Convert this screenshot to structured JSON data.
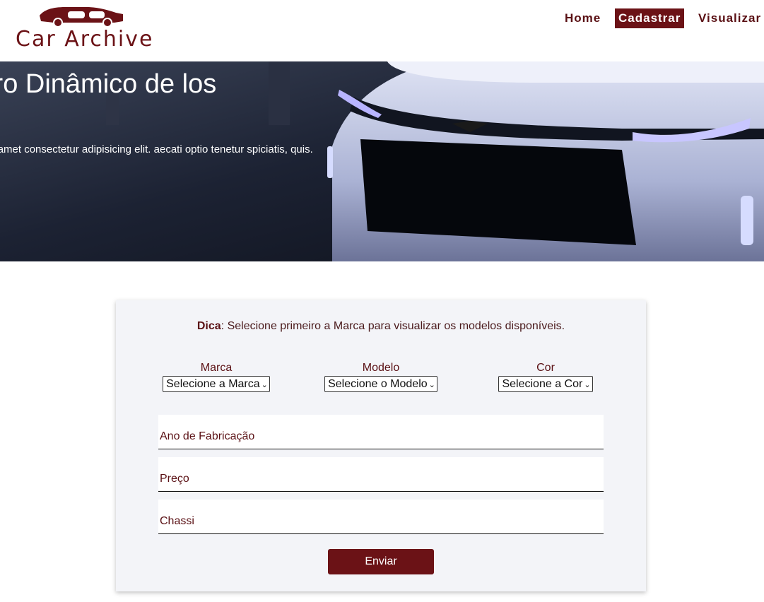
{
  "brand": {
    "name": "Car Archive",
    "color": "#6b1216",
    "icon": "car-icon"
  },
  "nav": {
    "home": "Home",
    "cadastrar": "Cadastrar",
    "visualizar": "Visualizar"
  },
  "hero": {
    "title": "stro Dinâmico de los",
    "text": "dolor sit amet consectetur adipisicing elit. aecati optio tenetur spiciatis, quis."
  },
  "form": {
    "tip_label": "Dica",
    "tip_text": ": Selecione primeiro a Marca para visualizar os modelos disponíveis.",
    "marca": {
      "label": "Marca",
      "selected": "Selecione a Marca"
    },
    "modelo": {
      "label": "Modelo",
      "selected": "Selecione o Modelo"
    },
    "cor": {
      "label": "Cor",
      "selected": "Selecione a Cor"
    },
    "ano_placeholder": "Ano de Fabricação",
    "preco_placeholder": "Preço",
    "chassi_placeholder": "Chassi",
    "submit": "Enviar"
  }
}
